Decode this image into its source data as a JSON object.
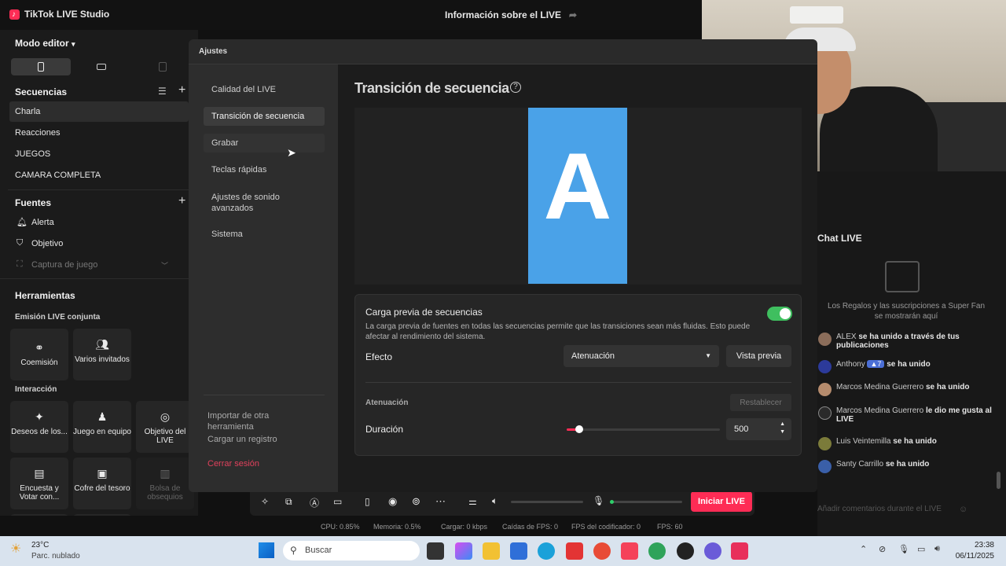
{
  "titlebar": {
    "app_name": "TikTok LIVE Studio",
    "center_title": "Información sobre el LIVE"
  },
  "left": {
    "mode_label": "Modo editor",
    "scenes_header": "Secuencias",
    "scenes": [
      "Charla",
      "Reacciones",
      "JUEGOS",
      "CAMARA COMPLETA"
    ],
    "sources_header": "Fuentes",
    "sources": [
      "Alerta",
      "Objetivo",
      "Captura de juego"
    ],
    "tools_header": "Herramientas",
    "joint_header": "Emisión LIVE conjunta",
    "joint_tools": [
      "Coemisión",
      "Varios invitados"
    ],
    "interaction_header": "Interacción",
    "interaction_tools": [
      "Deseos de los...",
      "Juego en equipo",
      "Objetivo del LIVE",
      "Encuesta y Votar con...",
      "Cofre del tesoro",
      "Bolsa de obsequios"
    ]
  },
  "modal": {
    "title": "Ajustes",
    "nav": [
      "Calidad del LIVE",
      "Transición de secuencia",
      "Grabar",
      "Teclas rápidas",
      "Ajustes de sonido avanzados",
      "Sistema"
    ],
    "nav_footer": [
      "Importar de otra herramienta",
      "Cargar un registro"
    ],
    "logout": "Cerrar sesión",
    "section_title": "Transición de secuencia",
    "preview_letter": "A",
    "preload_title": "Carga previa de secuencias",
    "preload_desc": "La carga previa de fuentes en todas las secuencias permite que las transiciones sean más fluidas. Esto puede afectar al rendimiento del sistema.",
    "effect_label": "Efecto",
    "effect_value": "Atenuación",
    "preview_button": "Vista previa",
    "sub_section": "Atenuación",
    "reset_button": "Restablecer",
    "duration_label": "Duración",
    "duration_value": "500",
    "toggle_on": true,
    "accent": "#3fbf5f"
  },
  "chat": {
    "title": "Chat LIVE",
    "gift_text": "Los Regalos y las suscripciones a Super Fan se mostrarán aquí",
    "messages": [
      {
        "user": "ALEX",
        "text": "se ha unido a través de tus publicaciones"
      },
      {
        "user": "Anthony",
        "badge": "7",
        "text": "se ha unido"
      },
      {
        "user": "Marcos Medina Guerrero",
        "text": "se ha unido"
      },
      {
        "user": "Marcos Medina Guerrero",
        "text": "le dio me gusta al LIVE"
      },
      {
        "user": "Luis Veintemilla",
        "text": "se ha unido"
      },
      {
        "user": "Santy Carrillo",
        "text": "se ha unido"
      }
    ],
    "input_placeholder": "Añadir comentarios durante el LIVE"
  },
  "controls": {
    "start_button": "Iniciar LIVE"
  },
  "status": {
    "cpu": "CPU: 0.85%",
    "memory": "Memoria: 0.5%",
    "upload": "Cargar: 0 kbps",
    "fps_drops": "Caídas de FPS: 0",
    "encoder_fps": "FPS del codificador: 0",
    "fps": "FPS: 60"
  },
  "taskbar": {
    "weather_temp": "23°C",
    "weather_desc": "Parc. nublado",
    "search": "Buscar",
    "time": "23:38",
    "date": "06/11/2025"
  }
}
